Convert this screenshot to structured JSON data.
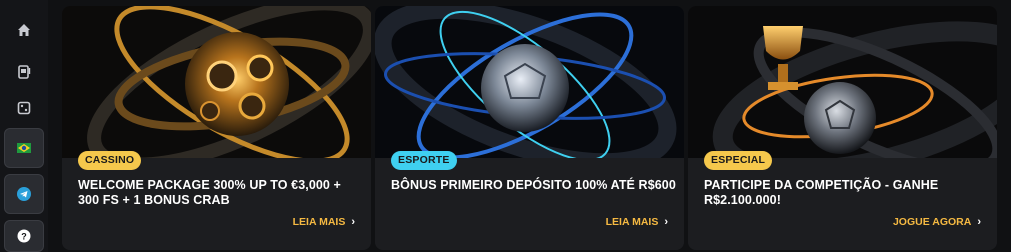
{
  "sidebar": {
    "items": [
      {
        "icon": "home-icon"
      },
      {
        "icon": "slot-machine-icon"
      },
      {
        "icon": "dice-icon"
      },
      {
        "icon": "brazil-flag-icon"
      },
      {
        "icon": "telegram-icon"
      },
      {
        "icon": "help-icon"
      }
    ]
  },
  "promos": [
    {
      "badge": "CASSINO",
      "badge_color": "#f5c84c",
      "title": "WELCOME PACKAGE 300% UP TO €3,000 + 300 FS + 1 BONUS CRAB",
      "cta": "LEIA MAIS",
      "art": "gold-rings-art"
    },
    {
      "badge": "ESPORTE",
      "badge_color": "#3fd0f0",
      "title": "BÔNUS PRIMEIRO DEPÓSITO 100% ATÉ R$600",
      "cta": "LEIA MAIS",
      "art": "blue-ball-art"
    },
    {
      "badge": "ESPECIAL",
      "badge_color": "#f5c84c",
      "title": "PARTICIPE DA COMPETIÇÃO - GANHE R$2.100.000!",
      "cta": "JOGUE AGORA",
      "art": "trophy-ball-art"
    }
  ],
  "colors": {
    "accent": "#f5b942",
    "background": "#101113",
    "card": "#1c1d20"
  }
}
